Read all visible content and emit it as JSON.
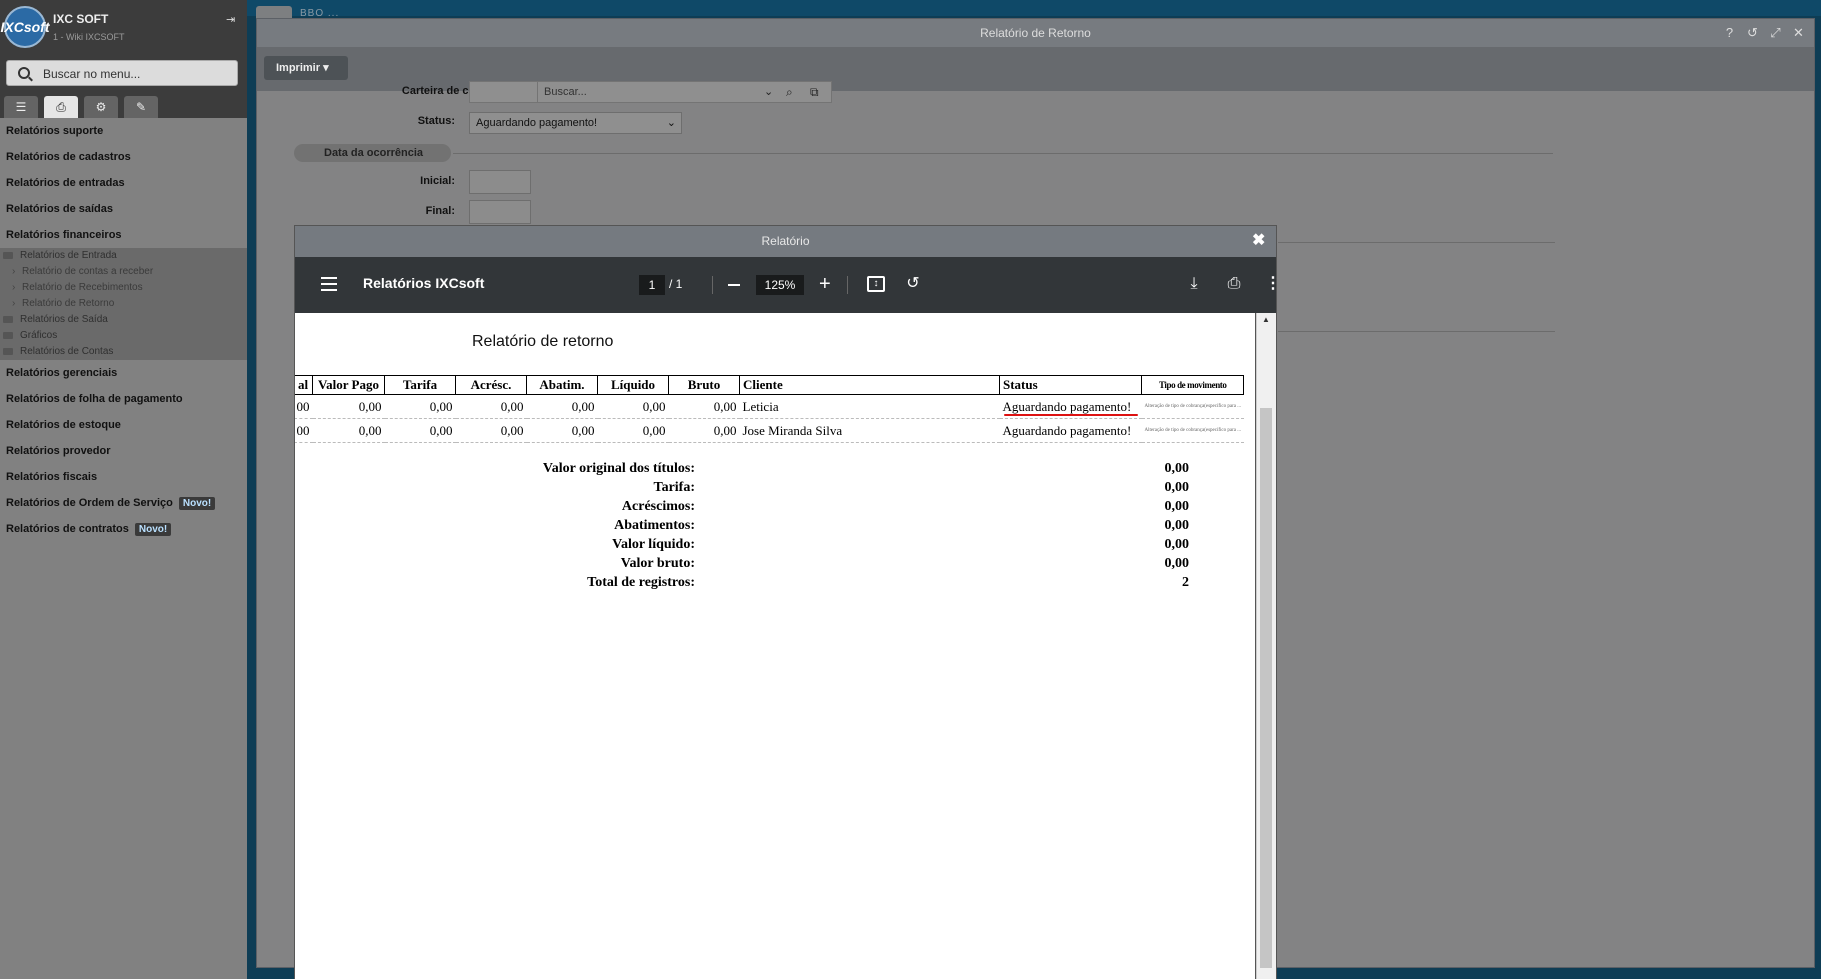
{
  "sidebar": {
    "title": "IXC SOFT",
    "subtitle": "1 - Wiki IXCSOFT",
    "logo_text": "IXCsoft",
    "search_placeholder": "Buscar no menu...",
    "items_top": [
      "Relatórios suporte",
      "Relatórios de cadastros",
      "Relatórios de entradas",
      "Relatórios de saídas",
      "Relatórios financeiros"
    ],
    "sub_group": {
      "folder_entrada": "Relatórios de Entrada",
      "leaves": [
        "Relatório de contas a receber",
        "Relatório de Recebimentos",
        "Relatório de Retorno"
      ],
      "folder_saida": "Relatórios de Saída",
      "folder_graficos": "Gráficos",
      "folder_contas": "Relatórios de Contas"
    },
    "items_bottom": [
      "Relatórios gerenciais",
      "Relatórios de folha de pagamento",
      "Relatórios de estoque",
      "Relatórios provedor",
      "Relatórios fiscais"
    ],
    "item_os": "Relatórios de Ordem de Serviço",
    "item_contratos": "Relatórios de contratos",
    "new_badge": "Novo!"
  },
  "main": {
    "title": "Relatório de Retorno",
    "print_button": "Imprimir ▾",
    "carteira_label": "Carteira de cobrança:",
    "carteira_placeholder": "Buscar...",
    "status_label": "Status:",
    "status_value": "Aguardando pagamento!",
    "section_label": "Data da ocorrência",
    "inicial_label": "Inicial:",
    "final_label": "Final:",
    "top_tab_text": "BBO ..."
  },
  "modal": {
    "title": "Relatório",
    "pdf": {
      "doc_title": "Relatórios IXCsoft",
      "page": "1",
      "page_total": "/   1",
      "zoom": "125%"
    },
    "report": {
      "title": "Relatório de retorno",
      "headers": [
        "al",
        "Valor Pago",
        "Tarifa",
        "Acrésc.",
        "Abatim.",
        "Líquido",
        "Bruto",
        "Cliente",
        "Status",
        "Tipo de movimento"
      ],
      "rows": [
        [
          "00",
          "0,00",
          "0,00",
          "0,00",
          "0,00",
          "0,00",
          "0,00",
          "Leticia",
          "Aguardando pagamento!",
          "Alteração de tipo de cobrança(específico para ..."
        ],
        [
          "00",
          "0,00",
          "0,00",
          "0,00",
          "0,00",
          "0,00",
          "0,00",
          "Jose Miranda Silva",
          "Aguardando pagamento!",
          "Alteração de tipo de cobrança(específico para ..."
        ]
      ],
      "totals": [
        {
          "label": "Valor original dos títulos:",
          "value": "0,00"
        },
        {
          "label": "Tarifa:",
          "value": "0,00"
        },
        {
          "label": "Acréscimos:",
          "value": "0,00"
        },
        {
          "label": "Abatimentos:",
          "value": "0,00"
        },
        {
          "label": "Valor líquido:",
          "value": "0,00"
        },
        {
          "label": "Valor bruto:",
          "value": "0,00"
        },
        {
          "label": "Total de registros:",
          "value": "2"
        }
      ]
    }
  }
}
